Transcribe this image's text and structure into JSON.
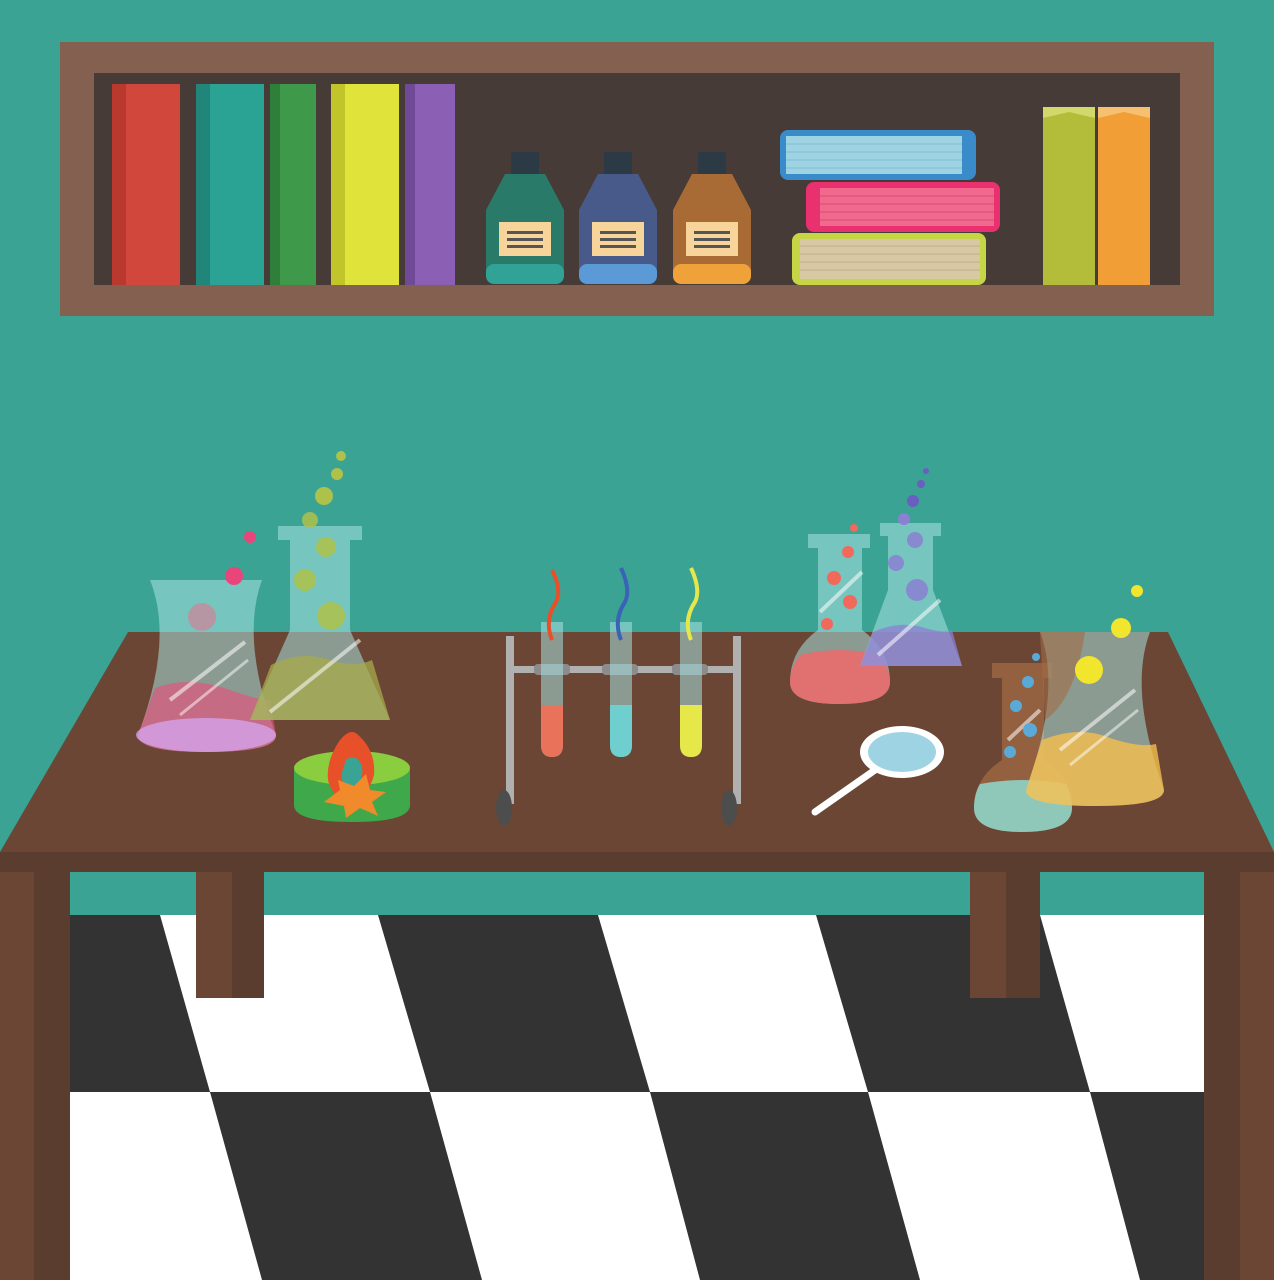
{
  "scene": {
    "colors": {
      "wall": "#3aa394",
      "shelf_frame": "#83604f",
      "shelf_back": "#473b37",
      "table_top": "#6b4634",
      "table_edge": "#5b3d2f",
      "floor_dark": "#333333",
      "floor_light": "#ffffff"
    },
    "shelf": {
      "books": [
        "red",
        "teal",
        "green",
        "yellow",
        "purple"
      ],
      "bottles": [
        "green",
        "blue",
        "orange"
      ],
      "book_stack": [
        "blue",
        "pink",
        "yellow-green"
      ],
      "right_books": [
        "olive",
        "orange"
      ]
    },
    "table": {
      "items": [
        "erlenmeyer-flask-pink",
        "erlenmeyer-flask-green",
        "bunsen-burner",
        "test-tube-rack",
        "round-flask-red",
        "erlenmeyer-flask-purple",
        "magnifying-glass",
        "round-flask-teal",
        "erlenmeyer-flask-yellow"
      ]
    }
  }
}
